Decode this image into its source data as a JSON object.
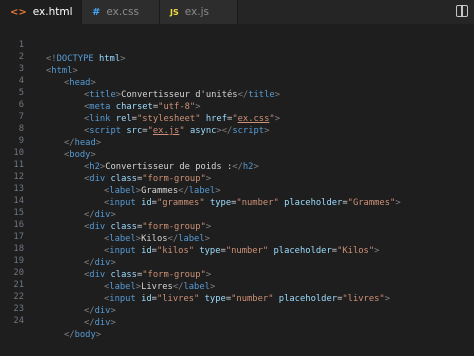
{
  "tabs": [
    {
      "label": "ex.html",
      "icon": "<>",
      "icon_name": "html-file-icon",
      "active": true,
      "icon_color": "#e37933"
    },
    {
      "label": "ex.css",
      "icon": "#",
      "icon_name": "css-file-icon",
      "active": false,
      "icon_color": "#42a5f5"
    },
    {
      "label": "ex.js",
      "icon": "JS",
      "icon_name": "js-file-icon",
      "active": false,
      "icon_color": "#f1dd3f"
    }
  ],
  "close_glyph": "✕",
  "lines": [
    "1",
    "2",
    "3",
    "4",
    "5",
    "6",
    "7",
    "8",
    "9",
    "10",
    "11",
    "12",
    "13",
    "14",
    "15",
    "16",
    "17",
    "18",
    "19",
    "20",
    "21",
    "22",
    "23",
    "24",
    "25",
    "26",
    "27",
    "28"
  ],
  "code": {
    "l1": {
      "a": "<!",
      "b": "DOCTYPE",
      "c": " html",
      "d": ">"
    },
    "l2": {
      "tag": "html"
    },
    "l3": {
      "tag": "head"
    },
    "l4": {
      "tag": "title",
      "text": "Convertisseur d'unités"
    },
    "l5": {
      "tag": "meta",
      "attr": "charset",
      "val": "\"utf-8\""
    },
    "l6": {
      "tag": "link",
      "attr1": "rel",
      "val1": "\"stylesheet\"",
      "attr2": "href",
      "val2a": "\"",
      "val2b": "ex.css",
      "val2c": "\""
    },
    "l7": {
      "tag": "script",
      "attr1": "src",
      "val1a": "\"",
      "val1b": "ex.js",
      "val1c": "\"",
      "attr2": "async"
    },
    "l8": {
      "tag": "head"
    },
    "l9": {
      "tag": "body"
    },
    "l10": {
      "tag": "h2",
      "text": "Convertisseur de poids :"
    },
    "l11": {
      "tag": "div",
      "attr": "class",
      "val": "\"form-group\""
    },
    "l12": {
      "tag": "label",
      "text": "Grammes"
    },
    "l13": {
      "tag": "input",
      "a1": "id",
      "v1": "\"grammes\"",
      "a2": "type",
      "v2": "\"number\"",
      "a3": "placeholder",
      "v3": "\"Grammes\""
    },
    "l14": {
      "tag": "div"
    },
    "l15": {
      "tag": "div",
      "attr": "class",
      "val": "\"form-group\""
    },
    "l16": {
      "tag": "label",
      "text": "Kilos"
    },
    "l17": {
      "tag": "input",
      "a1": "id",
      "v1": "\"kilos\"",
      "a2": "type",
      "v2": "\"number\"",
      "a3": "placeholder",
      "v3": "\"Kilos\""
    },
    "l18": {
      "tag": "div"
    },
    "l19": {
      "tag": "div",
      "attr": "class",
      "val": "\"form-group\""
    },
    "l20": {
      "tag": "label",
      "text": "Livres"
    },
    "l21": {
      "tag": "input",
      "a1": "id",
      "v1": "\"livres\"",
      "a2": "type",
      "v2": "\"number\"",
      "a3": "placeholder",
      "v3": "\"livres\""
    },
    "l22": {
      "tag": "div"
    },
    "l23": {
      "tag": "div"
    },
    "l24": {
      "tag": "body"
    },
    "l25": {
      "tag": "html"
    }
  },
  "punct": {
    "lt": "<",
    "gt": ">",
    "lts": "</",
    "eq": "="
  }
}
